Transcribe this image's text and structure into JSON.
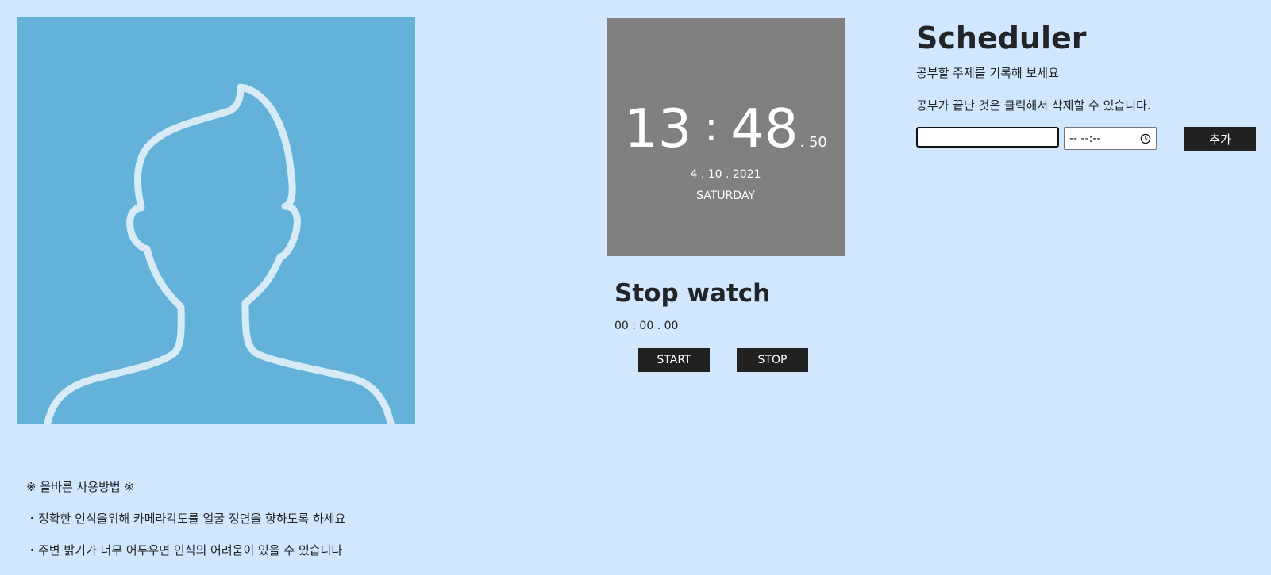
{
  "profile": {
    "icon": "user-silhouette-icon",
    "background_color": "#64b1da",
    "outline_color": "#d6ebf6"
  },
  "usage": {
    "heading": "※ 올바른 사용방법 ※",
    "tips": [
      "・정확한 인식을위해 카메라각도를 얼굴 정면을 향하도록 하세요",
      "・주변 밝기가 너무 어두우면 인식의 어려움이 있을 수 있습니다"
    ]
  },
  "clock": {
    "hours": "13",
    "separator": ":",
    "minutes": "48",
    "centiseconds": ". 50",
    "date": "4 . 10 . 2021",
    "weekday": "SATURDAY",
    "background_color": "#808080"
  },
  "stopwatch": {
    "title": "Stop watch",
    "display": "00 : 00 . 00",
    "start_label": "START",
    "stop_label": "STOP"
  },
  "scheduler": {
    "title": "Scheduler",
    "description1": "공부할 주제를 기록해 보세요",
    "description2": "공부가 끝난 것은 클릭해서 삭제할 수 있습니다.",
    "task_input_value": "",
    "time_input_placeholder": "-- --:--",
    "add_label": "추가"
  },
  "colors": {
    "page_background": "#d1e7fd",
    "button_background": "#212121",
    "button_text": "#ffffff"
  }
}
